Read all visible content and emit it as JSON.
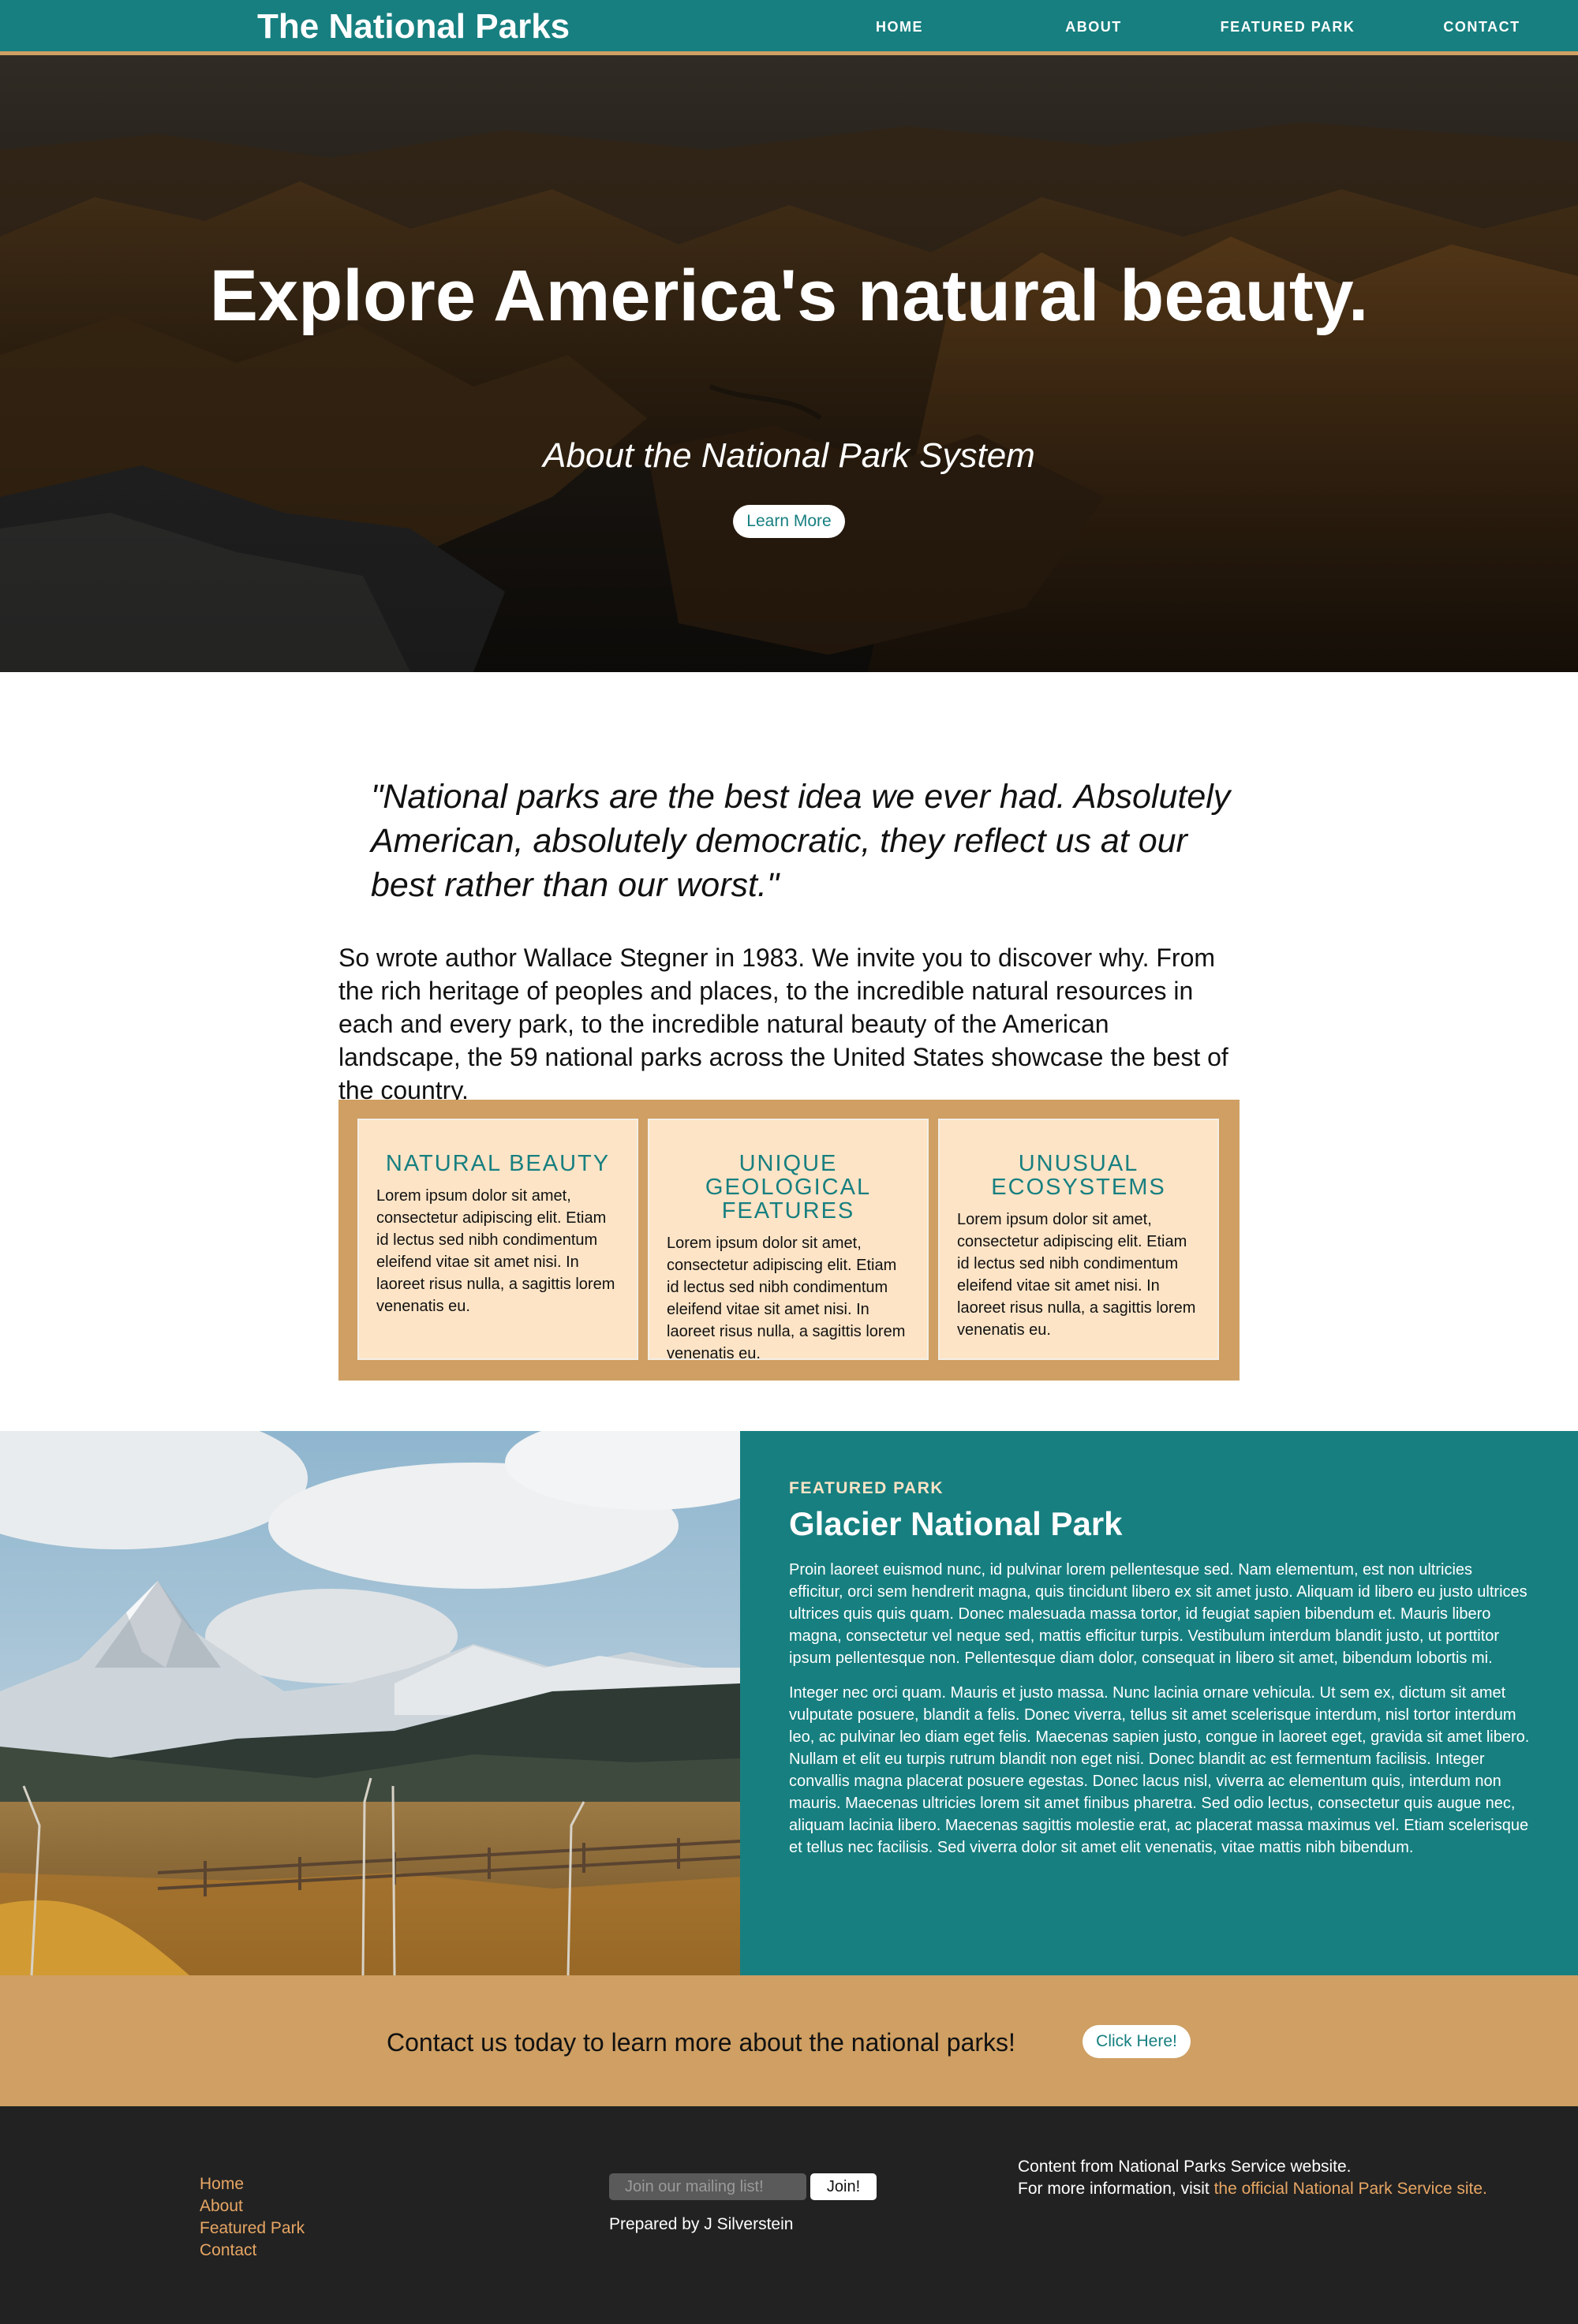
{
  "nav": {
    "brand": "The National Parks",
    "links": [
      "HOME",
      "ABOUT",
      "FEATURED PARK",
      "CONTACT"
    ],
    "color": "#177f80",
    "accent": "#cfa064"
  },
  "hero": {
    "title": "Explore America's natural beauty.",
    "subtitle": "About the National Park System",
    "button": "Learn More"
  },
  "intro": {
    "quote": "\"National parks are the best idea we ever had. Absolutely American, absolutely democratic, they reflect us at our best rather than our worst.\"",
    "paragraph": "So wrote author Wallace Stegner in 1983. We invite you to discover why. From the rich heritage of peoples and places, to the incredible natural resources in each and every park, to the incredible natural beauty of the American landscape, the 59 national parks across the United States showcase the best of the country."
  },
  "features": [
    {
      "title": "NATURAL BEAUTY",
      "body": "Lorem ipsum dolor sit amet, consectetur adipiscing elit. Etiam id lectus sed nibh condimentum eleifend vitae sit amet nisi. In laoreet risus nulla, a sagittis lorem venenatis eu."
    },
    {
      "title": "UNIQUE GEOLOGICAL FEATURES",
      "body": "Lorem ipsum dolor sit amet, consectetur adipiscing elit. Etiam id lectus sed nibh condimentum eleifend vitae sit amet nisi. In laoreet risus nulla, a sagittis lorem venenatis eu."
    },
    {
      "title": "UNUSUAL ECOSYSTEMS",
      "body": "Lorem ipsum dolor sit amet, consectetur adipiscing elit. Etiam id lectus sed nibh condimentum eleifend vitae sit amet nisi. In laoreet risus nulla, a sagittis lorem venenatis eu."
    }
  ],
  "featured_park": {
    "eyebrow": "FEATURED PARK",
    "title": "Glacier National Park",
    "paragraphs": [
      "Proin laoreet euismod nunc, id pulvinar lorem pellentesque sed. Nam elementum, est non ultricies efficitur, orci sem hendrerit magna, quis tincidunt libero ex sit amet justo. Aliquam id libero eu justo ultrices ultrices quis quis quam. Donec malesuada massa tortor, id feugiat sapien bibendum et. Mauris libero magna, consectetur vel neque sed, mattis efficitur turpis. Vestibulum interdum blandit justo, ut porttitor ipsum pellentesque non. Pellentesque diam dolor, consequat in libero sit amet, bibendum lobortis mi.",
      "Integer nec orci quam. Mauris et justo massa. Nunc lacinia ornare vehicula. Ut sem ex, dictum sit amet vulputate posuere, blandit a felis. Donec viverra, tellus sit amet scelerisque interdum, nisl tortor interdum leo, ac pulvinar leo diam eget felis. Maecenas sapien justo, congue in laoreet eget, gravida sit amet libero. Nullam et elit eu turpis rutrum blandit non eget nisi. Donec blandit ac est fermentum facilisis. Integer convallis magna placerat posuere egestas. Donec lacus nisl, viverra ac elementum quis, interdum non mauris. Maecenas ultricies lorem sit amet finibus pharetra. Sed odio lectus, consectetur quis augue nec, aliquam lacinia libero. Maecenas sagittis molestie erat, ac placerat massa maximus vel. Etiam scelerisque et tellus nec facilisis. Sed viverra dolor sit amet elit venenatis, vitae mattis nibh bibendum."
    ]
  },
  "cta": {
    "text": "Contact us today to learn more about the national parks!",
    "button": "Click Here!"
  },
  "footer": {
    "links": [
      "Home",
      "About",
      "Featured Park",
      "Contact"
    ],
    "join_placeholder": "Join our mailing list!",
    "join_button": "Join!",
    "prepared": "Prepared by J Silverstein",
    "info_line1": "Content from National Parks Service website.",
    "info_line2": "For more information, visit ",
    "info_link": "the official National Park Service site."
  }
}
